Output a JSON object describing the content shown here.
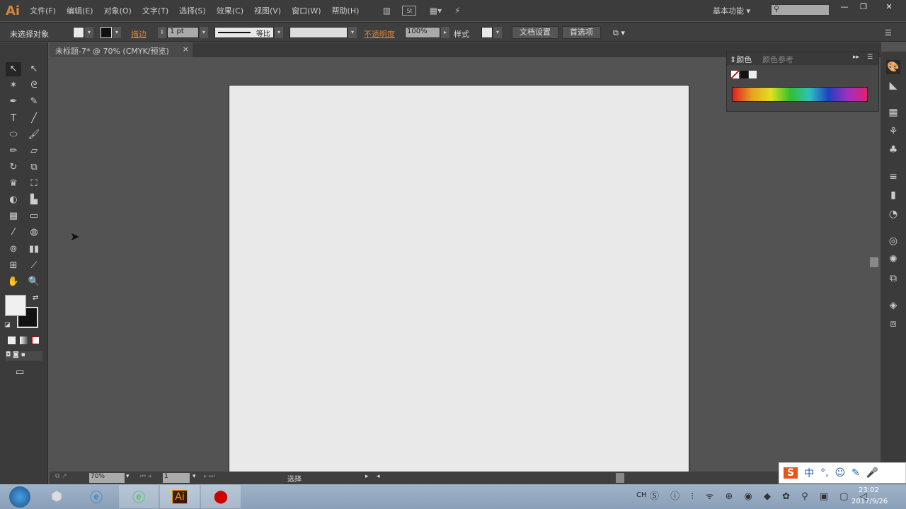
{
  "app": {
    "logo": "Ai",
    "accent": "#d8843a"
  },
  "menu": [
    "文件(F)",
    "编辑(E)",
    "对象(O)",
    "文字(T)",
    "选择(S)",
    "效果(C)",
    "视图(V)",
    "窗口(W)",
    "帮助(H)"
  ],
  "window": {
    "workspace": "基本功能",
    "search_placeholder": "",
    "minimize": "—",
    "restore": "❐",
    "close": "✕"
  },
  "control": {
    "selection": "未选择对象",
    "stroke_label": "描边",
    "stroke_weight": "1 pt",
    "stroke_profile": "等比",
    "opacity_label": "不透明度",
    "opacity": "100%",
    "style_label": "样式",
    "doc_setup": "文档设置",
    "preferences": "首选项"
  },
  "document": {
    "tab_title": "未标题-7* @ 70% (CMYK/预览)",
    "close": "×"
  },
  "color_panel": {
    "tab_active": "颜色",
    "tab_inactive": "颜色参考"
  },
  "status": {
    "zoom": "70%",
    "artboard": "1",
    "tool": "选择"
  },
  "ime": {
    "brand": "S",
    "mode": "中"
  },
  "taskbar": {
    "clock_time": "23:02",
    "clock_date": "2017/9/26",
    "lang": "CH",
    "ai_label": "Ai"
  }
}
